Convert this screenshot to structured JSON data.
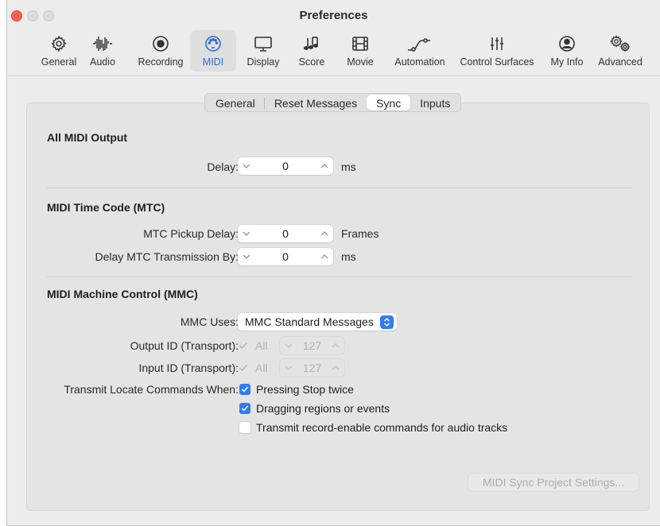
{
  "window": {
    "title": "Preferences"
  },
  "toolbar": {
    "items": [
      {
        "label": "General",
        "icon": "gear-icon"
      },
      {
        "label": "Audio",
        "icon": "waveform-icon"
      },
      {
        "label": "Recording",
        "icon": "record-icon"
      },
      {
        "label": "MIDI",
        "icon": "midi-port-icon",
        "selected": true
      },
      {
        "label": "Display",
        "icon": "display-icon"
      },
      {
        "label": "Score",
        "icon": "music-notes-icon"
      },
      {
        "label": "Movie",
        "icon": "film-icon"
      },
      {
        "label": "Automation",
        "icon": "automation-curve-icon"
      },
      {
        "label": "Control Surfaces",
        "icon": "sliders-icon"
      },
      {
        "label": "My Info",
        "icon": "person-icon"
      },
      {
        "label": "Advanced",
        "icon": "gears-icon"
      }
    ]
  },
  "tabs": [
    {
      "label": "General"
    },
    {
      "label": "Reset Messages"
    },
    {
      "label": "Sync",
      "active": true
    },
    {
      "label": "Inputs"
    }
  ],
  "all_midi_output": {
    "title": "All MIDI Output",
    "delay_label": "Delay:",
    "delay_value": "0",
    "delay_unit": "ms"
  },
  "mtc": {
    "title": "MIDI Time Code (MTC)",
    "pickup_label": "MTC Pickup Delay:",
    "pickup_value": "0",
    "pickup_unit": "Frames",
    "transmission_label": "Delay MTC Transmission By:",
    "transmission_value": "0",
    "transmission_unit": "ms"
  },
  "mmc": {
    "title": "MIDI Machine Control (MMC)",
    "uses_label": "MMC Uses:",
    "uses_value": "MMC Standard Messages",
    "output_id_label": "Output ID (Transport):",
    "output_all_label": "All",
    "output_id_value": "127",
    "input_id_label": "Input ID (Transport):",
    "input_all_label": "All",
    "input_id_value": "127",
    "transmit_label": "Transmit Locate Commands When:",
    "options": [
      {
        "label": "Pressing Stop twice",
        "checked": true
      },
      {
        "label": "Dragging regions or events",
        "checked": true
      },
      {
        "label": "Transmit record-enable commands for audio tracks",
        "checked": false
      }
    ]
  },
  "sync_settings_button": "MIDI Sync Project Settings...",
  "colors": {
    "accent": "#2f7cf6",
    "close": "#fe5f57"
  }
}
